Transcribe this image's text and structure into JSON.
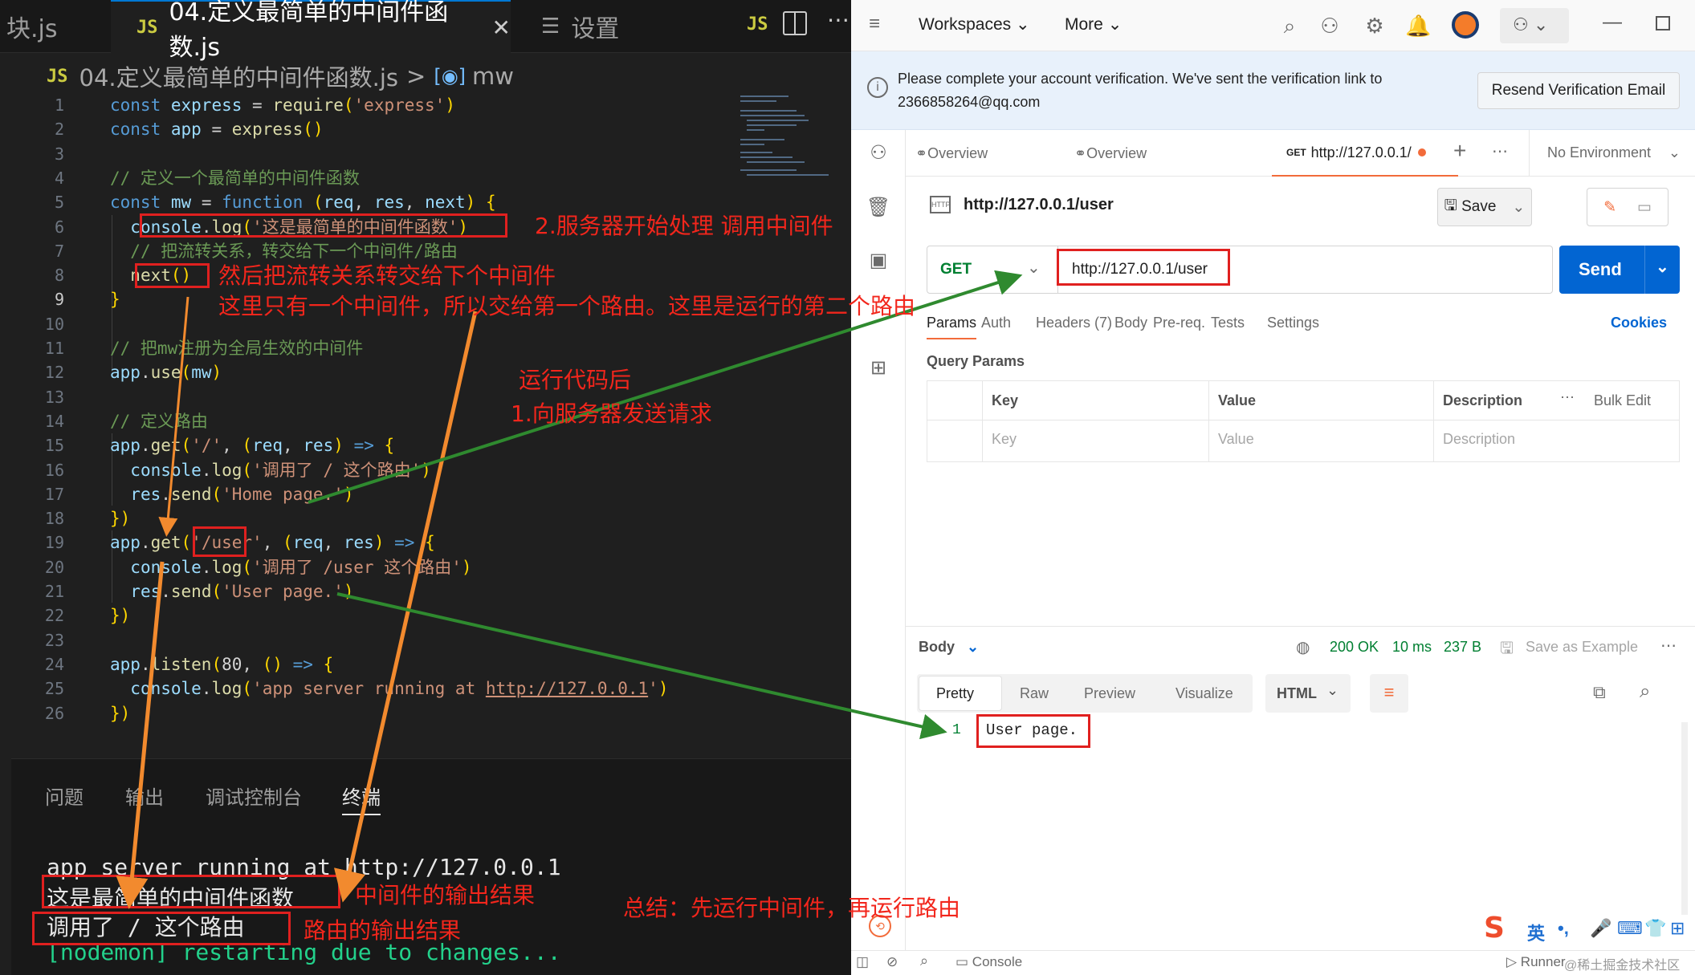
{
  "vscode": {
    "tabs": [
      {
        "label": "块.js",
        "active": false
      },
      {
        "label": "04.定义最简单的中间件函数.js",
        "active": true,
        "close": "✕"
      },
      {
        "label": "设置",
        "active": false
      }
    ],
    "breadcrumb": {
      "file": "04.定义最简单的中间件函数.js",
      "separator": ">",
      "symbol": "mw"
    },
    "line_numbers": [
      "1",
      "2",
      "3",
      "4",
      "5",
      "6",
      "7",
      "8",
      "9",
      "10",
      "11",
      "12",
      "13",
      "14",
      "15",
      "16",
      "17",
      "18",
      "19",
      "20",
      "21",
      "22",
      "23",
      "24",
      "25",
      "26"
    ],
    "panel_tabs": [
      "问题",
      "输出",
      "调试控制台",
      "终端"
    ],
    "terminal": [
      "app server running at http://127.0.0.1",
      "这是最简单的中间件函数",
      "调用了 / 这个路由",
      "[nodemon] restarting due to changes..."
    ]
  },
  "postman": {
    "nav": {
      "workspaces": "Workspaces",
      "more": "More"
    },
    "banner": {
      "text": "Please complete your account verification. We've sent the verification link to",
      "email": "2366858264@qq.com",
      "button": "Resend Verification Email"
    },
    "request_tabs": [
      {
        "label": "Overview"
      },
      {
        "label": "Overview"
      },
      {
        "method": "GET",
        "label": "http://127.0.0.1/"
      }
    ],
    "environment": "No Environment",
    "request_name": "http://127.0.0.1/user",
    "save_label": "Save",
    "method": "GET",
    "url": "http://127.0.0.1/user",
    "send_label": "Send",
    "sub_tabs": [
      "Params",
      "Auth",
      "Headers (7)",
      "Body",
      "Pre-req.",
      "Tests",
      "Settings"
    ],
    "cookies_label": "Cookies",
    "query_params_title": "Query Params",
    "table_headers": {
      "key": "Key",
      "value": "Value",
      "description": "Description",
      "bulk_edit": "Bulk Edit"
    },
    "table_placeholders": {
      "key": "Key",
      "value": "Value",
      "description": "Description"
    },
    "response": {
      "body_label": "Body",
      "status": "200 OK",
      "time": "10 ms",
      "size": "237 B",
      "save_example": "Save as Example",
      "view_tabs": [
        "Pretty",
        "Raw",
        "Preview",
        "Visualize"
      ],
      "format": "HTML",
      "line_number": "1",
      "content": "User page."
    },
    "status_bar": {
      "console": "Console",
      "runner": "Runner"
    },
    "ime": {
      "lang": "英",
      "punct": "•,"
    },
    "watermark": "@稀土掘金技术社区"
  },
  "annotations": {
    "a1": "2.服务器开始处理 调用中间件",
    "a2": "然后把流转关系转交给下个中间件",
    "a3": "这里只有一个中间件，所以交给第一个路由。这里是运行的第二个路由",
    "a4": "运行代码后",
    "a5": "1.向服务器发送请求",
    "a6": "中间件的输出结果",
    "a7": "路由的输出结果",
    "a8": "总结：先运行中间件，再运行路由"
  },
  "colors": {
    "annotation_red": "#f2261c",
    "arrow_orange": "#f28a2e",
    "arrow_green": "#2f8a2f",
    "send_blue": "#0265d2"
  }
}
